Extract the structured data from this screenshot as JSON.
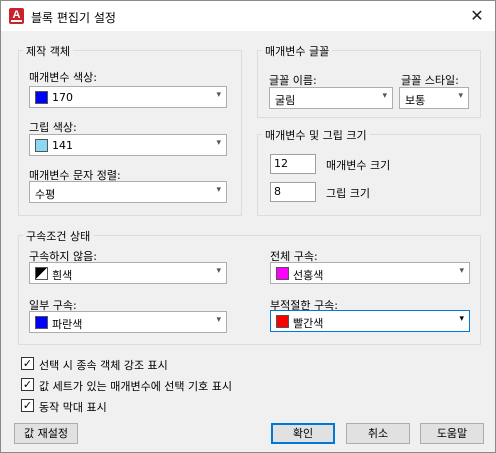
{
  "window": {
    "title": "블록 편집기 설정",
    "app_icon_letter": "A",
    "close_glyph": "✕"
  },
  "create_objects": {
    "title": "제작 객체",
    "param_color": {
      "label": "매개변수 색상:",
      "value": "170",
      "swatch": "#0000ff"
    },
    "grip_color": {
      "label": "그립 색상:",
      "value": "141",
      "swatch": "#8ad8f2"
    },
    "param_text_align": {
      "label": "매개변수 문자 정렬:",
      "value": "수평"
    }
  },
  "param_font": {
    "title": "매개변수 글꼴",
    "font_name": {
      "label": "글꼴 이름:",
      "value": "굴림"
    },
    "font_style": {
      "label": "글꼴 스타일:",
      "value": "보통"
    }
  },
  "sizes": {
    "title": "매개변수 및 그립 크기",
    "param_size": {
      "value": "12",
      "label": "매개변수 크기"
    },
    "grip_size": {
      "value": "8",
      "label": "그립 크기"
    }
  },
  "constraint_status": {
    "title": "구속조건 상태",
    "unconstrained": {
      "label": "구속하지 않음:",
      "value": "흰색"
    },
    "fully_constrained": {
      "label": "전체 구속:",
      "value": "선홍색",
      "swatch": "#ff00ff"
    },
    "partially_constrained": {
      "label": "일부 구속:",
      "value": "파란색",
      "swatch": "#0000ff"
    },
    "improperly_constrained": {
      "label": "부적절한 구속:",
      "value": "빨간색",
      "swatch": "#ff0000"
    }
  },
  "options": [
    {
      "label": "선택 시 종속 객체 강조 표시",
      "checked": true
    },
    {
      "label": "값 세트가 있는 매개변수에 선택 기호 표시",
      "checked": true
    },
    {
      "label": "동작 막대 표시",
      "checked": true
    }
  ],
  "buttons": {
    "reset": "값 재설정",
    "ok": "확인",
    "cancel": "취소",
    "help": "도움말"
  },
  "glyphs": {
    "check": "✓",
    "dropdown": "▾"
  }
}
